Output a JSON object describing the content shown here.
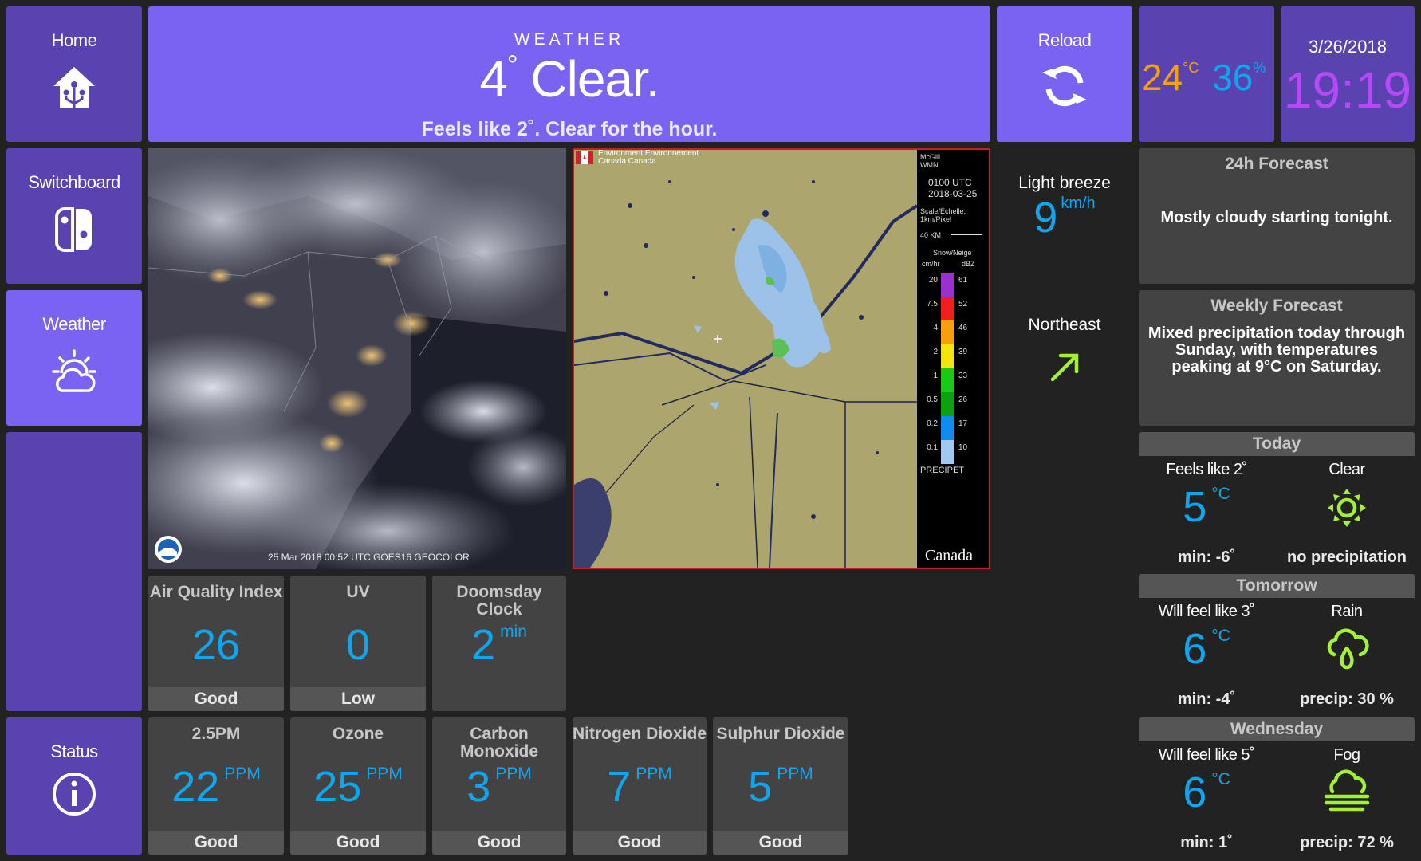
{
  "nav": {
    "home": "Home",
    "switchboard": "Switchboard",
    "weather": "Weather",
    "status": "Status"
  },
  "weather_header": {
    "caption": "WEATHER",
    "temp": "4",
    "deg": "°",
    "condition": "Clear.",
    "summary": "Feels like 2˚. Clear for the hour."
  },
  "reload": {
    "label": "Reload"
  },
  "indoor": {
    "temp": "24",
    "temp_unit": "°C",
    "humidity": "36",
    "humidity_unit": "%"
  },
  "clock": {
    "date": "3/26/2018",
    "time": "19:19"
  },
  "satellite": {
    "caption": "25 Mar 2018 00:52 UTC GOES16 GEOCOLOR",
    "logo": "NOAA STAR"
  },
  "radar": {
    "agency": "Environment Environnement Canada Canada",
    "station": "McGill WMN",
    "time": "0100 UTC",
    "date": "2018-03-25",
    "scale": "Scale/Échelle: 1km/Pixel",
    "scale_bar": "40 KM",
    "legend_title": "Snow/Neige",
    "unit_left": "cm/hr",
    "unit_right": "dBZ",
    "legend_left": [
      "20",
      "7.5",
      "4",
      "2",
      "1",
      "0.5",
      "0.2",
      "0.1"
    ],
    "legend_right": [
      "61",
      "52",
      "46",
      "39",
      "33",
      "26",
      "17",
      "10"
    ],
    "legend_colors": [
      "#9b30d0",
      "#f01e1e",
      "#f5a00a",
      "#f5e60a",
      "#19c819",
      "#0fa00f",
      "#0f8cf0",
      "#a0c8f0"
    ],
    "product": "PRECIPET",
    "wordmark": "Canada"
  },
  "wind": {
    "description": "Light breeze",
    "speed": "9",
    "unit": "km/h",
    "direction": "Northeast"
  },
  "forecast24": {
    "title": "24h Forecast",
    "text": "Mostly cloudy starting tonight."
  },
  "forecastWeekly": {
    "title": "Weekly Forecast",
    "text": "Mixed precipitation today through Sunday, with temperatures peaking at 9°C on Saturday."
  },
  "days": [
    {
      "name": "Today",
      "feels": "Feels like 2˚",
      "temp": "5",
      "unit": "°C",
      "condition": "Clear",
      "icon": "sun-icon",
      "min": "min: -6˚",
      "precip": "no precipitation"
    },
    {
      "name": "Tomorrow",
      "feels": "Will feel like 3˚",
      "temp": "6",
      "unit": "°C",
      "condition": "Rain",
      "icon": "rain-cloud-icon",
      "min": "min: -4˚",
      "precip": "precip: 30 %"
    },
    {
      "name": "Wednesday",
      "feels": "Will feel like 5˚",
      "temp": "6",
      "unit": "°C",
      "condition": "Fog",
      "icon": "fog-icon",
      "min": "min: 1˚",
      "precip": "precip: 72 %"
    }
  ],
  "metrics_top": [
    {
      "title": "Air Quality Index",
      "value": "26",
      "unit": "",
      "status": "Good"
    },
    {
      "title": "UV",
      "value": "0",
      "unit": "",
      "status": "Low"
    },
    {
      "title": "Doomsday Clock",
      "value": "2",
      "unit": "min",
      "status": ""
    }
  ],
  "metrics_bottom": [
    {
      "title": "2.5PM",
      "value": "22",
      "unit": "PPM",
      "status": "Good"
    },
    {
      "title": "Ozone",
      "value": "25",
      "unit": "PPM",
      "status": "Good"
    },
    {
      "title": "Carbon Monoxide",
      "value": "3",
      "unit": "PPM",
      "status": "Good"
    },
    {
      "title": "Nitrogen Dioxide",
      "value": "7",
      "unit": "PPM",
      "status": "Good"
    },
    {
      "title": "Sulphur Dioxide",
      "value": "5",
      "unit": "PPM",
      "status": "Good"
    }
  ],
  "colors": {
    "accent": "#7963f0",
    "nav": "#5a43b0",
    "value_blue": "#0fa6f0",
    "icon_green": "#a4f032",
    "clock_violet": "#b44af5",
    "temp_orange": "#f5a00c"
  }
}
